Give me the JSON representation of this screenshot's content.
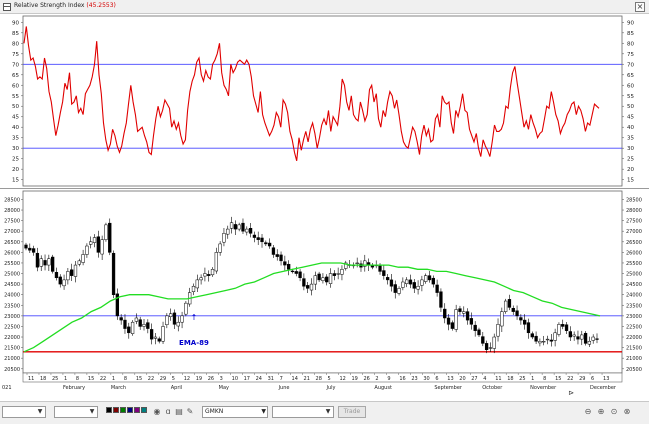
{
  "rsi_panel": {
    "title": "Relative Strength Index",
    "value": "(45.2553)",
    "close_glyph": "×"
  },
  "toolbar": {
    "symbol": "GMKN",
    "trade_label": "Trade"
  },
  "colors": {
    "rsi_line": "#e00000",
    "ema_line": "#22dd22",
    "level_line": "#4444ff",
    "support_line": "#e00000",
    "candle": "#000000",
    "annotation": "#0000cc"
  },
  "chart_data": [
    {
      "type": "line",
      "yticks": [
        "90",
        "85",
        "80",
        "75",
        "70",
        "65",
        "60",
        "55",
        "50",
        "45",
        "40",
        "35",
        "30",
        "25",
        "20",
        "15"
      ],
      "ylim": [
        12,
        93
      ],
      "levels": [
        70,
        30
      ],
      "series": [
        {
          "values": [
            80,
            88,
            79,
            72,
            73,
            69,
            63,
            64,
            63,
            73,
            68,
            57,
            52,
            44,
            36,
            41,
            47,
            52,
            61,
            58,
            66,
            51,
            52,
            55,
            47,
            49,
            46,
            56,
            58,
            60,
            64,
            70,
            81,
            65,
            56,
            42,
            34,
            29,
            32,
            39,
            36,
            31,
            28,
            31,
            37,
            42,
            51,
            60,
            52,
            46,
            38,
            39,
            40,
            36,
            33,
            28,
            27,
            36,
            44,
            50,
            45,
            48,
            53,
            51,
            49,
            40,
            43,
            39,
            42,
            36,
            32,
            34,
            48,
            57,
            62,
            65,
            71,
            73,
            65,
            62,
            67,
            64,
            63,
            70,
            72,
            75,
            80,
            66,
            60,
            58,
            55,
            70,
            66,
            68,
            71,
            72,
            71,
            70,
            72,
            70,
            64,
            55,
            51,
            47,
            57,
            46,
            42,
            39,
            36,
            38,
            41,
            47,
            45,
            40,
            53,
            51,
            47,
            38,
            34,
            28,
            24,
            35,
            29,
            34,
            38,
            33,
            39,
            42,
            37,
            30,
            35,
            41,
            44,
            41,
            48,
            38,
            45,
            43,
            41,
            50,
            63,
            60,
            52,
            48,
            55,
            46,
            44,
            43,
            52,
            48,
            43,
            46,
            58,
            60,
            52,
            56,
            44,
            40,
            48,
            45,
            52,
            57,
            55,
            49,
            53,
            46,
            38,
            33,
            31,
            30,
            35,
            40,
            38,
            33,
            27,
            36,
            41,
            36,
            39,
            33,
            34,
            44,
            46,
            40,
            55,
            52,
            51,
            52,
            42,
            37,
            48,
            45,
            50,
            56,
            48,
            47,
            39,
            36,
            33,
            37,
            30,
            26,
            34,
            31,
            29,
            26,
            33,
            41,
            38,
            38,
            39,
            42,
            50,
            49,
            59,
            66,
            69,
            61,
            54,
            47,
            40,
            43,
            39,
            46,
            42,
            39,
            35,
            37,
            38,
            44,
            50,
            49,
            57,
            52,
            46,
            43,
            37,
            40,
            42,
            46,
            48,
            51,
            52,
            46,
            50,
            48,
            44,
            38,
            42,
            41,
            46,
            51,
            50,
            49
          ]
        }
      ]
    },
    {
      "type": "candlestick",
      "yticks": [
        "28500",
        "28000",
        "27500",
        "27000",
        "26500",
        "26000",
        "25500",
        "25000",
        "24500",
        "24000",
        "23500",
        "23000",
        "22500",
        "22000",
        "21500",
        "21000",
        "20500"
      ],
      "ylim": [
        20300,
        28900
      ],
      "xticks": [
        "11",
        "18",
        "25",
        "1",
        "8",
        "15",
        "22",
        "1",
        "8",
        "15",
        "22",
        "29",
        "5",
        "12",
        "19",
        "26",
        "3",
        "10",
        "17",
        "24",
        "31",
        "7",
        "14",
        "21",
        "28",
        "5",
        "12",
        "19",
        "26",
        "2",
        "9",
        "16",
        "23",
        "30",
        "6",
        "13",
        "20",
        "27",
        "4",
        "11",
        "18",
        "25",
        "1",
        "8",
        "15",
        "22",
        "29",
        "6",
        "13"
      ],
      "months": [
        "021",
        "February",
        "March",
        "April",
        "May",
        "June",
        "July",
        "August",
        "September",
        "October",
        "November",
        "December"
      ],
      "levels": [
        23000,
        21300
      ],
      "annotation": {
        "label": "EMA-89",
        "arrow": "↑",
        "x_index": 52,
        "y": 23000
      },
      "close": [
        26200,
        26100,
        26000,
        25300,
        25700,
        25400,
        25700,
        25100,
        24800,
        24500,
        24700,
        25100,
        24900,
        25400,
        25600,
        25900,
        26300,
        26500,
        26700,
        26000,
        26600,
        27300,
        26000,
        24000,
        23000,
        22800,
        22400,
        22200,
        22700,
        22900,
        22500,
        22600,
        22400,
        21900,
        22000,
        21800,
        22500,
        23000,
        23100,
        22600,
        22700,
        23000,
        23600,
        24100,
        24400,
        24700,
        24800,
        25000,
        24900,
        25200,
        26000,
        26400,
        26900,
        27100,
        27400,
        27100,
        27300,
        27000,
        27100,
        26900,
        26700,
        26600,
        26500,
        26400,
        26300,
        25900,
        25800,
        25600,
        25400,
        25200,
        25100,
        25000,
        24800,
        24400,
        24300,
        24500,
        24900,
        24700,
        24800,
        24600,
        25000,
        24900,
        25000,
        25200,
        25500,
        25400,
        25400,
        25500,
        25300,
        25600,
        25400,
        25300,
        25400,
        25100,
        24900,
        24700,
        24400,
        24100,
        24300,
        24600,
        24700,
        24500,
        24300,
        24400,
        24700,
        24900,
        24700,
        24500,
        24100,
        23400,
        22900,
        22600,
        22400,
        23300,
        23200,
        23200,
        22800,
        22600,
        22300,
        22100,
        21700,
        21400,
        21500,
        22000,
        22600,
        23200,
        23700,
        23400,
        23200,
        23000,
        22800,
        22600,
        22200,
        22000,
        21800,
        21800,
        21800,
        21900,
        21800,
        22200,
        22600,
        22500,
        22300,
        22000,
        22100,
        21900,
        22100,
        21700,
        21800,
        22000,
        21900
      ]
    },
    {
      "type": "line",
      "series": [
        {
          "values": [
            21300,
            21500,
            21800,
            22100,
            22400,
            22700,
            22900,
            23200,
            23400,
            23700,
            23900,
            24000,
            24000,
            24000,
            23900,
            23800,
            23800,
            23800,
            23900,
            24000,
            24100,
            24200,
            24300,
            24500,
            24600,
            24800,
            25000,
            25100,
            25200,
            25300,
            25400,
            25500,
            25500,
            25500,
            25400,
            25400,
            25400,
            25400,
            25400,
            25300,
            25300,
            25200,
            25200,
            25100,
            25100,
            25000,
            24900,
            24800,
            24700,
            24600,
            24400,
            24200,
            24100,
            23900,
            23700,
            23600,
            23400,
            23300,
            23200,
            23100,
            23000
          ]
        }
      ]
    }
  ]
}
